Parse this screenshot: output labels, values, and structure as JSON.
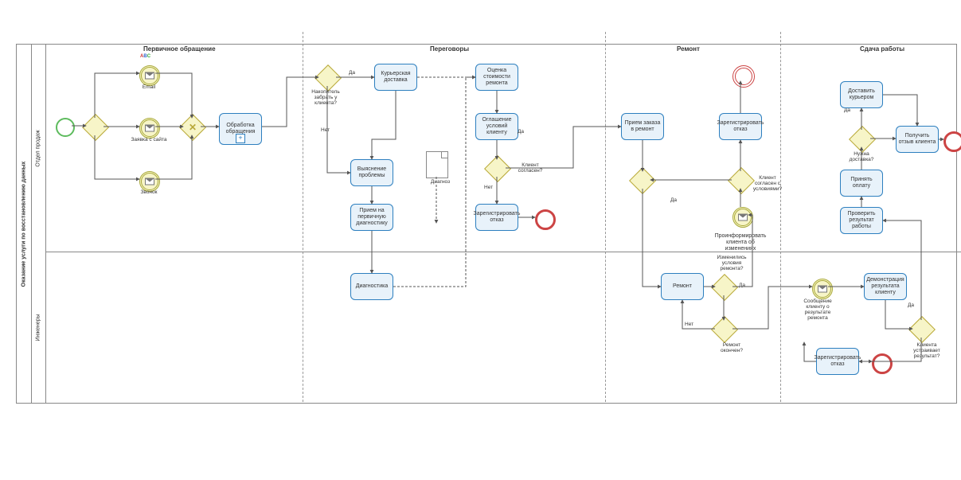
{
  "pool_title": "Оказание услуги по восстановлению данных",
  "lanes": {
    "sales": "Отдел продаж",
    "engineers": "Инженеры"
  },
  "phases": {
    "p1": "Первичное обращение",
    "p2": "Переговоры",
    "p3": "Ремонт",
    "p4": "Сдача работы"
  },
  "tasks": {
    "t_obr": "Обработка обращения",
    "t_courier": "Курьерская доставка",
    "t_figure": "Выяснение проблемы",
    "t_prim_diag": "Прием на первичную диагностику",
    "t_diag": "Диагностика",
    "t_estimate": "Оценка стоимости ремонта",
    "t_terms": "Оглашение условий клиенту",
    "t_reg_refuse1": "Зарегистрировать отказ",
    "t_accept": "Прием заказа в ремонт",
    "t_repair": "Ремонт",
    "t_reg_refuse2": "Зарегистрировать отказ",
    "t_inform": "Проинформировать клиента об изменениях",
    "t_demo": "Демонстрация результата клиенту",
    "t_reg_refuse3": "Зарегистрировать отказ",
    "t_check": "Проверить результат работы",
    "t_pay": "Принять оплату",
    "t_deliver": "Доставить курьером",
    "t_feedback": "Получить отзыв клиента"
  },
  "events": {
    "start": "",
    "ev_email": "Email",
    "ev_site": "Заявка с сайта",
    "ev_call": "Звонок",
    "ev_result_msg": "Сообщение клиенту о результате ремонта",
    "doc_diagnosis": "Диагноз"
  },
  "gateways": {
    "gw_pickup": "Накопитель забрать у клиента?",
    "gw_agree": "Клиент согласен?",
    "gw_changed": "Изменились условия ремонта?",
    "gw_done": "Ремонт окончен?",
    "gw_agree2": "Клиент согласен с условиями?",
    "gw_ok": "Клиента устраивает результат?",
    "gw_need_delivery": "Нужна доставка?"
  },
  "labels": {
    "yes": "Да",
    "no": "Нет"
  },
  "chart_data": {
    "type": "bpmn",
    "pool": "Оказание услуги по восстановлению данных",
    "lanes": [
      "Отдел продаж",
      "Инженеры"
    ],
    "phases": [
      "Первичное обращение",
      "Переговоры",
      "Ремонт",
      "Сдача работы"
    ]
  }
}
